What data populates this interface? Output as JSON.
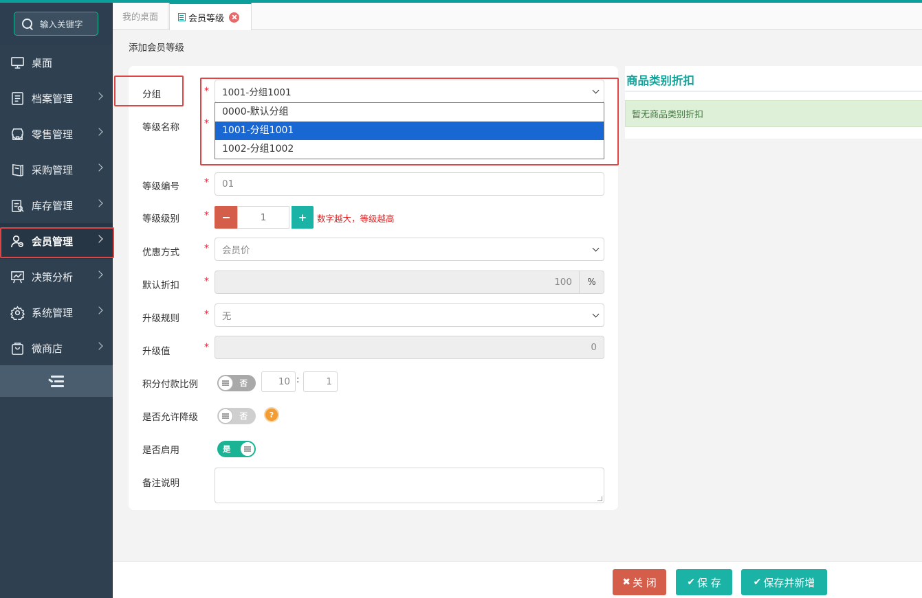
{
  "search": {
    "placeholder": "输入关键字"
  },
  "sidebar": {
    "items": [
      {
        "label": "桌面",
        "icon": "monitor-icon",
        "has_arrow": false
      },
      {
        "label": "档案管理",
        "icon": "archive-icon",
        "has_arrow": true
      },
      {
        "label": "零售管理",
        "icon": "store-icon",
        "has_arrow": true
      },
      {
        "label": "采购管理",
        "icon": "book-icon",
        "has_arrow": true
      },
      {
        "label": "库存管理",
        "icon": "inventory-icon",
        "has_arrow": true
      },
      {
        "label": "会员管理",
        "icon": "member-icon",
        "has_arrow": true,
        "active": true
      },
      {
        "label": "决策分析",
        "icon": "chart-board-icon",
        "has_arrow": true
      },
      {
        "label": "系统管理",
        "icon": "gear-icon",
        "has_arrow": true
      },
      {
        "label": "微商店",
        "icon": "shopping-bag-icon",
        "has_arrow": true
      }
    ],
    "collapse_icon": "collapse-menu-icon"
  },
  "tabs": [
    {
      "label": "我的桌面",
      "active": false
    },
    {
      "label": "会员等级",
      "active": true
    }
  ],
  "page": {
    "title": "添加会员等级"
  },
  "form": {
    "group": {
      "label": "分组",
      "value": "1001-分组1001",
      "options": [
        "0000-默认分组",
        "1001-分组1001",
        "1002-分组1002"
      ],
      "selected_index": 1
    },
    "level_name": {
      "label": "等级名称",
      "value": ""
    },
    "level_code": {
      "label": "等级编号",
      "value": "01"
    },
    "level_rank": {
      "label": "等级级别",
      "value": "1",
      "minus": "−",
      "plus": "+",
      "hint": "数字越大，等级越高"
    },
    "discount_mode": {
      "label": "优惠方式",
      "value": "会员价"
    },
    "default_discount": {
      "label": "默认折扣",
      "value": "100",
      "unit": "%"
    },
    "upgrade_rule": {
      "label": "升级规则",
      "value": "无"
    },
    "upgrade_value": {
      "label": "升级值",
      "value": "0"
    },
    "points_ratio": {
      "label": "积分付款比例",
      "toggle": "否",
      "left": "10",
      "sep": ":",
      "right": "1"
    },
    "allow_downgrade": {
      "label": "是否允许降级",
      "toggle": "否",
      "help": "?"
    },
    "enabled": {
      "label": "是否启用",
      "toggle": "是"
    },
    "remark": {
      "label": "备注说明",
      "value": ""
    },
    "required_mark": "*"
  },
  "right_panel": {
    "title": "商品类别折扣",
    "empty_text": "暂无商品类别折扣"
  },
  "footer": {
    "close": "关 闭",
    "save": "保 存",
    "save_new": "保存并新增"
  },
  "colors": {
    "accent": "#1ab3a6",
    "sidebar_bg": "#2f4050",
    "danger": "#d55e4b",
    "highlight_box": "#e04545",
    "selected_option": "#1967d2"
  }
}
